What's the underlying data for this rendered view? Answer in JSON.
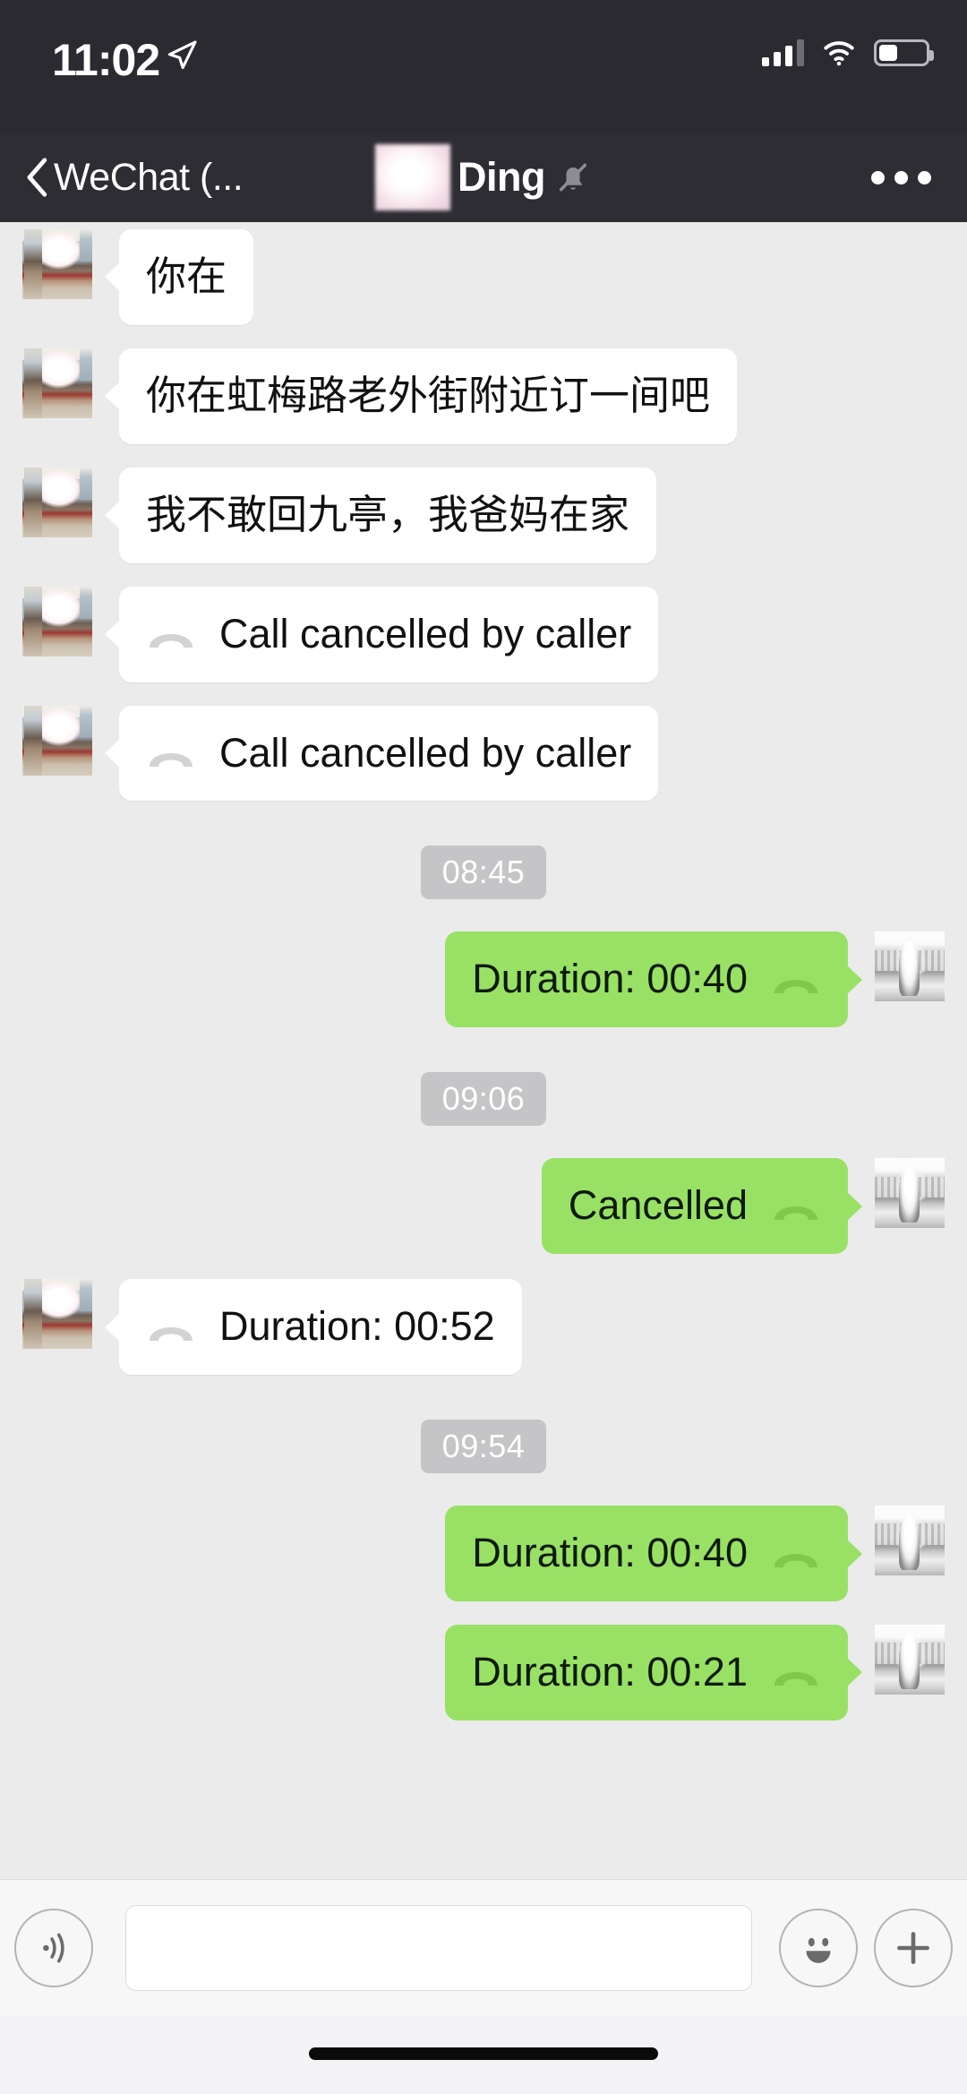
{
  "status_bar": {
    "time": "11:02",
    "location_icon": "location-arrow-icon",
    "signal_icon": "cellular-signal-icon",
    "signal_bars_filled": 3,
    "signal_bars_total": 4,
    "wifi_icon": "wifi-icon",
    "battery_icon": "battery-icon",
    "battery_level_percent": 36
  },
  "nav_bar": {
    "back_icon": "chevron-left-icon",
    "back_label": "WeChat (...",
    "contact_name": "Ding",
    "contact_name_redacted": true,
    "mute_icon": "bell-muted-icon",
    "more_icon": "more-horizontal-icon"
  },
  "conversation": {
    "messages": [
      {
        "id": "m1",
        "side": "incoming",
        "kind": "text",
        "text": "你在",
        "avatar": "contact-avatar"
      },
      {
        "id": "m2",
        "side": "incoming",
        "kind": "text",
        "text": "你在虹梅路老外街附近订一间吧",
        "avatar": "contact-avatar"
      },
      {
        "id": "m3",
        "side": "incoming",
        "kind": "text",
        "text": "我不敢回九亭，我爸妈在家",
        "avatar": "contact-avatar"
      },
      {
        "id": "m4",
        "side": "incoming",
        "kind": "call",
        "text": "Call cancelled by caller",
        "icon": "phone-handset-icon",
        "avatar": "contact-avatar"
      },
      {
        "id": "m5",
        "side": "incoming",
        "kind": "call",
        "text": "Call cancelled by caller",
        "icon": "phone-handset-icon",
        "avatar": "contact-avatar"
      },
      {
        "id": "t1",
        "kind": "timestamp",
        "text": "08:45"
      },
      {
        "id": "m6",
        "side": "outgoing",
        "kind": "call",
        "text": "Duration: 00:40",
        "icon": "phone-handset-icon",
        "avatar": "self-avatar"
      },
      {
        "id": "t2",
        "kind": "timestamp",
        "text": "09:06"
      },
      {
        "id": "m7",
        "side": "outgoing",
        "kind": "call",
        "text": "Cancelled",
        "icon": "phone-handset-icon",
        "avatar": "self-avatar"
      },
      {
        "id": "m8",
        "side": "incoming",
        "kind": "call",
        "text": "Duration: 00:52",
        "icon": "phone-handset-icon",
        "avatar": "contact-avatar"
      },
      {
        "id": "t3",
        "kind": "timestamp",
        "text": "09:54"
      },
      {
        "id": "m9",
        "side": "outgoing",
        "kind": "call",
        "text": "Duration: 00:40",
        "icon": "phone-handset-icon",
        "avatar": "self-avatar"
      },
      {
        "id": "m10",
        "side": "outgoing",
        "kind": "call",
        "text": "Duration: 00:21",
        "icon": "phone-handset-icon",
        "avatar": "self-avatar",
        "clipped": true
      }
    ]
  },
  "input_bar": {
    "voice_icon": "voice-wave-icon",
    "message_input_value": "",
    "message_input_placeholder": "",
    "emoji_icon": "smiley-face-icon",
    "plus_icon": "plus-icon"
  },
  "home_indicator": "home-indicator-bar",
  "colors": {
    "status_bar_bg": "#2c2a31",
    "nav_bar_bg": "#2f2d34",
    "chat_bg": "#ebebeb",
    "incoming_bubble": "#ffffff",
    "outgoing_bubble": "#98e165",
    "timestamp_pill": "#c5c5c7",
    "input_bar_bg": "#f7f7f7"
  }
}
